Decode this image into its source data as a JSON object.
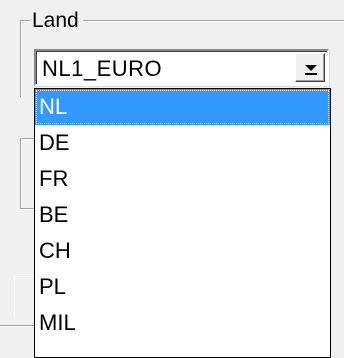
{
  "group": {
    "label": "Land"
  },
  "combo": {
    "value": "NL1_EURO",
    "open": true
  },
  "dropdown": {
    "selected_index": 0,
    "items": [
      "NL",
      "DE",
      "FR",
      "BE",
      "CH",
      "PL",
      "MIL"
    ]
  },
  "colors": {
    "selection": "#3399ff",
    "window": "#f0f0f0",
    "list_background": "#ffffff"
  }
}
